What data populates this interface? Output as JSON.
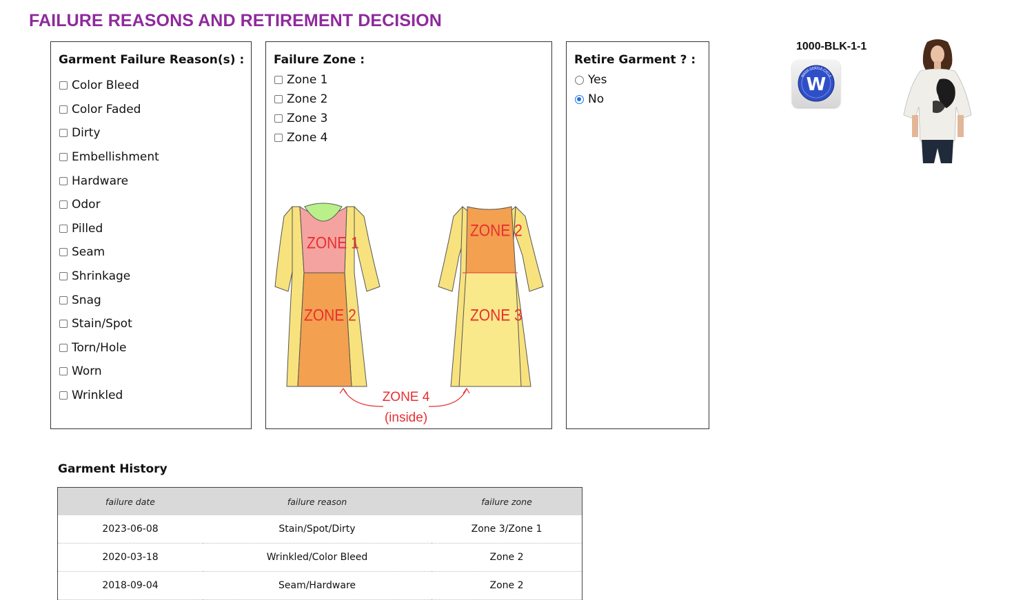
{
  "page": {
    "title": "FAILURE REASONS AND RETIREMENT DECISION",
    "title_color": "#8e2a9c"
  },
  "reasons": {
    "label": "Garment Failure Reason(s) :",
    "options": [
      "Color Bleed",
      "Color Faded",
      "Dirty",
      "Embellishment",
      "Hardware",
      "Odor",
      "Pilled",
      "Seam",
      "Shrinkage",
      "Snag",
      "Stain/Spot",
      "Torn/Hole",
      "Worn",
      "Wrinkled"
    ]
  },
  "zones": {
    "label": "Failure Zone :",
    "options": [
      "Zone 1",
      "Zone 2",
      "Zone 3",
      "Zone 4"
    ],
    "diagram": {
      "front_zone_1": "ZONE 1",
      "front_zone_2": "ZONE 2",
      "back_zone_2": "ZONE 2",
      "back_zone_3": "ZONE 3",
      "zone_4": "ZONE 4",
      "zone_4_note": "(inside)",
      "colors": {
        "zone_1": "#f4a3a0",
        "zone_2": "#f3a050",
        "zone_3": "#f9e98a",
        "sleeve": "#f7e27e",
        "neck": "#b9f08a",
        "label": "#e83030"
      }
    }
  },
  "retire": {
    "label": "Retire Garment ? :",
    "options": [
      {
        "label": "Yes",
        "selected": false
      },
      {
        "label": "No",
        "selected": true
      }
    ],
    "accent": "#1a73e8"
  },
  "product": {
    "sku": "1000-BLK-1-1",
    "care_letter": "W",
    "care_text": "WASH GENTLE CYCLE",
    "care_color": "#2f4fc8",
    "care_icon": "wash-gentle-cycle-icon"
  },
  "history": {
    "title": "Garment History",
    "columns": [
      "failure date",
      "failure reason",
      "failure zone"
    ],
    "rows": [
      [
        "2023-06-08",
        "Stain/Spot/Dirty",
        "Zone 3/Zone 1"
      ],
      [
        "2020-03-18",
        "Wrinkled/Color Bleed",
        "Zone 2"
      ],
      [
        "2018-09-04",
        "Seam/Hardware",
        "Zone 2"
      ]
    ]
  }
}
